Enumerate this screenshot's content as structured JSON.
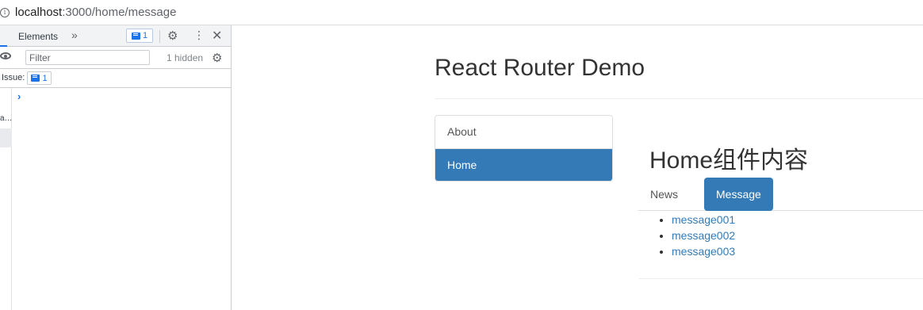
{
  "browser": {
    "url_host": "localhost",
    "url_path": ":3000/home/message"
  },
  "devtools": {
    "tab_label": "Elements",
    "more_tabs": "»",
    "issue_count": "1",
    "filter_placeholder": "Filter",
    "hidden_count": "1 hidden",
    "issues_label": "Issue:",
    "issues_badge_count": "1",
    "truncated_text": "a…",
    "prompt": "›",
    "close": "✕",
    "kebab": "⋮",
    "gear": "⚙"
  },
  "app": {
    "title": "React Router Demo",
    "nav": [
      {
        "label": "About",
        "active": false
      },
      {
        "label": "Home",
        "active": true
      }
    ],
    "home_title": "Home组件内容",
    "tabs": [
      {
        "label": "News",
        "active": false
      },
      {
        "label": "Message",
        "active": true
      }
    ],
    "messages": [
      "message001",
      "message002",
      "message003"
    ]
  },
  "colors": {
    "primary": "#337ab7",
    "devtools_accent": "#1a73e8"
  }
}
